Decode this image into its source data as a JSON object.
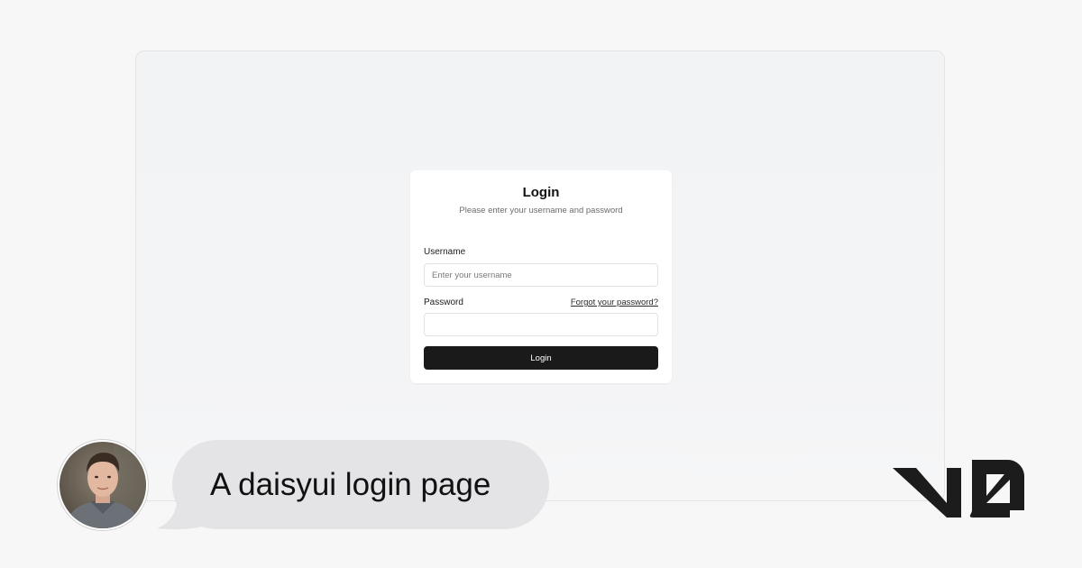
{
  "login_card": {
    "title": "Login",
    "subtitle": "Please enter your username and password",
    "username_label": "Username",
    "username_placeholder": "Enter your username",
    "username_value": "",
    "password_label": "Password",
    "password_value": "",
    "forgot_link": "Forgot your password?",
    "submit_label": "Login"
  },
  "chat": {
    "prompt": "A daisyui login page",
    "avatar_icon": "user-avatar-photo"
  },
  "brand": {
    "logo_text": "v0",
    "logo_icon": "v0-logo-icon"
  },
  "colors": {
    "button_bg": "#1a1a1b",
    "bubble_bg": "#e4e4e6",
    "page_bg": "#f7f7f7"
  }
}
